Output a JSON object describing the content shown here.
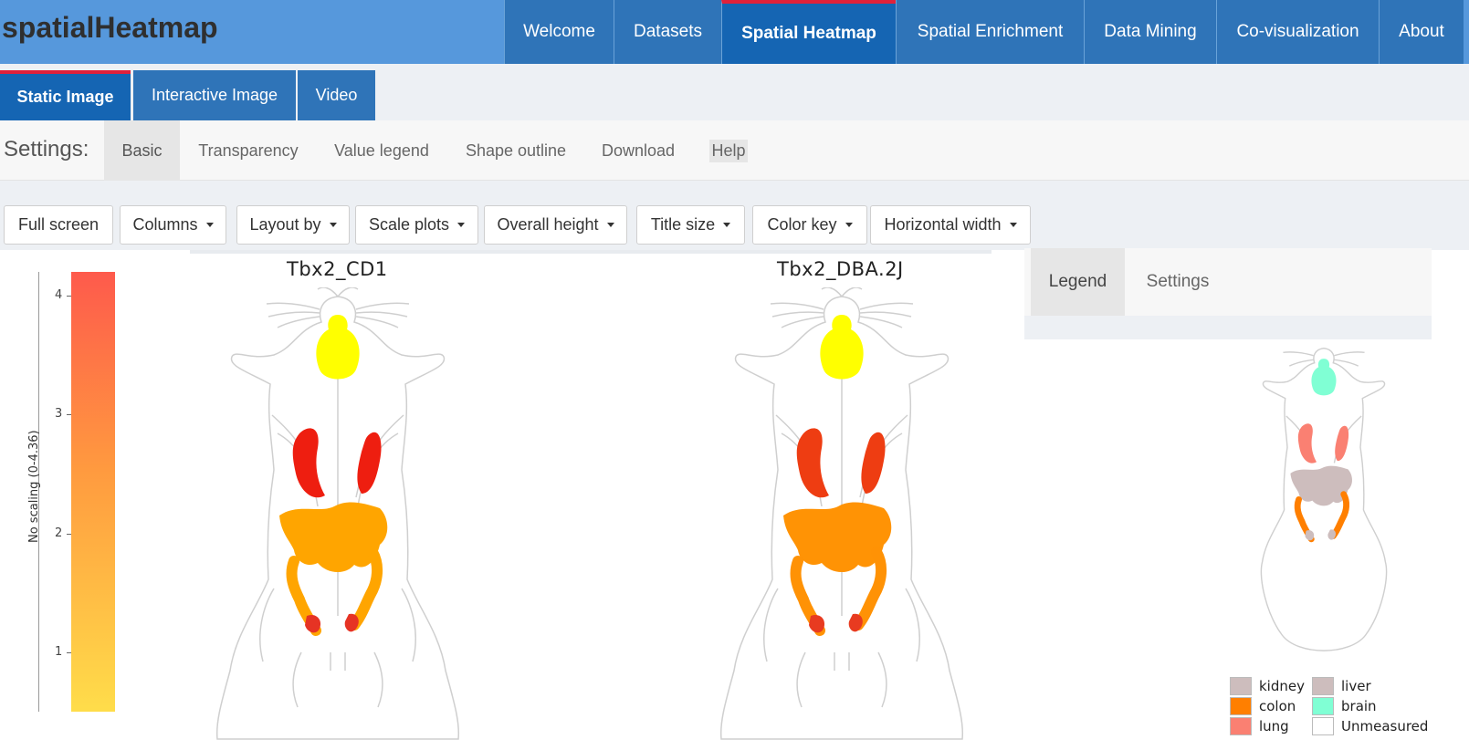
{
  "app": {
    "brand": "spatialHeatmap"
  },
  "nav": [
    {
      "label": "Welcome",
      "active": false
    },
    {
      "label": "Datasets",
      "active": false
    },
    {
      "label": "Spatial Heatmap",
      "active": true
    },
    {
      "label": "Spatial Enrichment",
      "active": false
    },
    {
      "label": "Data Mining",
      "active": false
    },
    {
      "label": "Co-visualization",
      "active": false
    },
    {
      "label": "About",
      "active": false
    }
  ],
  "subtabs": [
    {
      "label": "Static Image",
      "active": true
    },
    {
      "label": "Interactive Image",
      "active": false
    },
    {
      "label": "Video",
      "active": false
    }
  ],
  "settings": {
    "label": "Settings:",
    "tabs": [
      {
        "label": "Basic",
        "active": true
      },
      {
        "label": "Transparency",
        "active": false
      },
      {
        "label": "Value legend",
        "active": false
      },
      {
        "label": "Shape outline",
        "active": false
      },
      {
        "label": "Download",
        "active": false
      },
      {
        "label": "Help",
        "active": false
      }
    ]
  },
  "toolbar": {
    "full_screen": "Full screen",
    "columns": "Columns",
    "layout_by": "Layout by",
    "scale_plots": "Scale plots",
    "overall_height": "Overall height",
    "title_size": "Title size",
    "color_key": "Color key",
    "horizontal_width": "Horizontal width"
  },
  "color_key": {
    "title": "No scaling (0-4.36)",
    "ticks": [
      "4",
      "3",
      "2",
      "1"
    ],
    "tick_values": [
      4,
      3,
      2,
      1
    ],
    "range": [
      0.5,
      4.2
    ],
    "colors": {
      "high": "#fe5a4c",
      "mid": "#ff9a3f",
      "low": "#ffdd4a"
    }
  },
  "plots": [
    {
      "title": "Tbx2_CD1",
      "colors": {
        "brain": "#ffff00",
        "lung": "#ee1e10",
        "liver": "#ffa500",
        "colon": "#ff9a0c",
        "kidney": "#e63324"
      }
    },
    {
      "title": "Tbx2_DBA.2J",
      "colors": {
        "brain": "#ffff00",
        "lung": "#ee3d12",
        "liver": "#ff9305",
        "colon": "#ff9205",
        "kidney": "#e83b20"
      }
    }
  ],
  "legend_panel": {
    "tabs": [
      {
        "label": "Legend",
        "active": true
      },
      {
        "label": "Settings",
        "active": false
      }
    ],
    "items": [
      {
        "label": "kidney",
        "color": "#cdbdbd"
      },
      {
        "label": "liver",
        "color": "#cdbdbd"
      },
      {
        "label": "colon",
        "color": "#ff7f00"
      },
      {
        "label": "brain",
        "color": "#80ffd4"
      },
      {
        "label": "lung",
        "color": "#fa8072"
      },
      {
        "label": "Unmeasured",
        "color": "#ffffff"
      }
    ]
  }
}
